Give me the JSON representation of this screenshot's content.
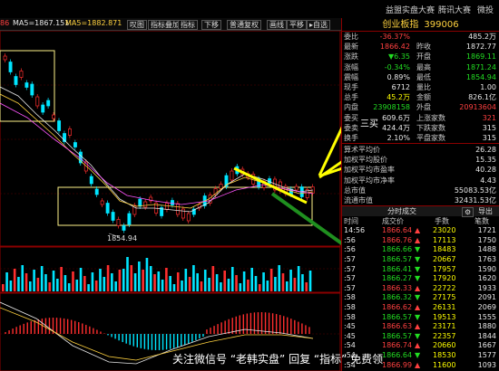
{
  "topbar": {
    "links": [
      "益盟实盘大赛",
      "腾讯大赛",
      "微投"
    ]
  },
  "toolbar": {
    "ma_left": "86",
    "ma5": "MA5=1867.151",
    "ma5_color": "#e8e8e8",
    "ma10": "MA5=1882.871",
    "ma10_color": "#ffd23f",
    "buttons": [
      "叹图",
      "指标叠加",
      "指标",
      "下移",
      "普通复权",
      "画线",
      "平移",
      "▸自选"
    ]
  },
  "chart": {
    "low_label": "1854.94",
    "annotation": "三买",
    "colors": {
      "up": "#ff2e2e",
      "down": "#00e5ff",
      "box": "#fff48a",
      "arrow": "#ffff00",
      "green_arrow": "#1f8f1f"
    }
  },
  "right_panel": {
    "title": "创业板指",
    "code": "399006",
    "quote": [
      {
        "l1": "委比",
        "v1": "-36.37%",
        "c1": "red",
        "l2": "",
        "v2": "485.2万",
        "c2": "wht"
      },
      {
        "l1": "最新",
        "v1": "1866.42",
        "c1": "red",
        "l2": "昨收",
        "v2": "1872.77",
        "c2": "wht"
      },
      {
        "l1": "涨跌",
        "v1": "▼6.35",
        "c1": "green",
        "l2": "开盘",
        "v2": "1869.11",
        "c2": "green"
      },
      {
        "l1": "涨幅",
        "v1": "-0.34%",
        "c1": "green",
        "l2": "最高",
        "v2": "1871.24",
        "c2": "green"
      },
      {
        "l1": "震幅",
        "v1": "0.89%",
        "c1": "wht",
        "l2": "最低",
        "v2": "1854.94",
        "c2": "green"
      },
      {
        "l1": "现手",
        "v1": "6712",
        "c1": "wht",
        "l2": "量比",
        "v2": "1.00",
        "c2": "wht"
      },
      {
        "l1": "总手",
        "v1": "45.2万",
        "c1": "yel",
        "l2": "金额",
        "v2": "826.1亿",
        "c2": "wht"
      },
      {
        "l1": "内盘",
        "v1": "23908158",
        "c1": "green",
        "l2": "外盘",
        "v2": "20913604",
        "c2": "red"
      },
      {
        "l1": "委买",
        "v1": "609.6万",
        "c1": "wht",
        "l2": "上涨家数",
        "v2": "321",
        "c2": "red"
      },
      {
        "l1": "委卖",
        "v1": "424.4万",
        "c1": "wht",
        "l2": "下跌家数",
        "v2": "315",
        "c2": "wht"
      },
      {
        "l1": "换手",
        "v1": "2.10%",
        "c1": "wht",
        "l2": "平盘家数",
        "v2": "315",
        "c2": "wht"
      }
    ],
    "stats": [
      {
        "label": "算术平均价",
        "value": "26.28"
      },
      {
        "label": "加权平均股价",
        "value": "15.35"
      },
      {
        "label": "加权平均市盈率",
        "value": "40.28"
      },
      {
        "label": "加权平均市净率",
        "value": "4.43"
      },
      {
        "label": "总市值",
        "value": "55083.53亿"
      },
      {
        "label": "流通市值",
        "value": "32431.53亿"
      }
    ],
    "ticks_header": "分时成交",
    "ticks_buttons": [
      "导出"
    ],
    "ticks_cols": [
      "时间",
      "成交价",
      "手数",
      "笔数"
    ],
    "ticks": [
      {
        "t": "14:56",
        "p": "1866.64",
        "d": "▲",
        "v": "23020",
        "n": "1721"
      },
      {
        "t": ":56",
        "p": "1866.76",
        "d": "▲",
        "v": "17113",
        "n": "1750"
      },
      {
        "t": ":56",
        "p": "1866.66",
        "d": "▼",
        "v": "18483",
        "n": "1488"
      },
      {
        "t": ":57",
        "p": "1866.57",
        "d": "▼",
        "v": "20667",
        "n": "1763"
      },
      {
        "t": ":57",
        "p": "1866.41",
        "d": "▼",
        "v": "17957",
        "n": "1590"
      },
      {
        "t": ":57",
        "p": "1866.27",
        "d": "▼",
        "v": "17920",
        "n": "1620"
      },
      {
        "t": ":57",
        "p": "1866.33",
        "d": "▲",
        "v": "22722",
        "n": "1933"
      },
      {
        "t": ":58",
        "p": "1866.32",
        "d": "▼",
        "v": "27175",
        "n": "2091"
      },
      {
        "t": ":58",
        "p": "1866.62",
        "d": "▲",
        "v": "26131",
        "n": "2069"
      },
      {
        "t": ":58",
        "p": "1866.57",
        "d": "▼",
        "v": "19513",
        "n": "1555"
      },
      {
        "t": ":45",
        "p": "1866.63",
        "d": "▲",
        "v": "23171",
        "n": "1880"
      },
      {
        "t": ":45",
        "p": "1866.57",
        "d": "▼",
        "v": "22357",
        "n": "1844"
      },
      {
        "t": ":54",
        "p": "1866.74",
        "d": "▲",
        "v": "20660",
        "n": "1667"
      },
      {
        "t": ":54",
        "p": "1866.64",
        "d": "▼",
        "v": "18530",
        "n": "1577"
      },
      {
        "t": ":54",
        "p": "1866.99",
        "d": "▲",
        "v": "11600",
        "n": "1093"
      }
    ]
  },
  "watermark": {
    "text": "关注微信号 “老韩实盘” 回复 “指标” 免费领"
  }
}
